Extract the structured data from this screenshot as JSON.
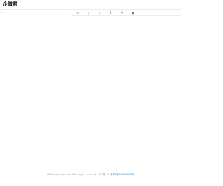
{
  "header": {
    "brand": "企微君"
  },
  "left_pane": {
    "caret": "▾"
  },
  "toolbar": {
    "tools": [
      {
        "name": "list-icon",
        "glyph": "☰"
      },
      {
        "name": "document-icon",
        "glyph": "▯"
      },
      {
        "name": "search-icon",
        "glyph": "⌕"
      },
      {
        "name": "bold-icon",
        "glyph": "B"
      },
      {
        "name": "font-color-icon",
        "glyph": "A"
      },
      {
        "name": "image-icon",
        "glyph": "▣"
      }
    ]
  },
  "footer": {
    "copyright": "©2024 qiweijun.com All right reserved. ICP备 No",
    "beian": "粤ICP备2023000000号"
  }
}
